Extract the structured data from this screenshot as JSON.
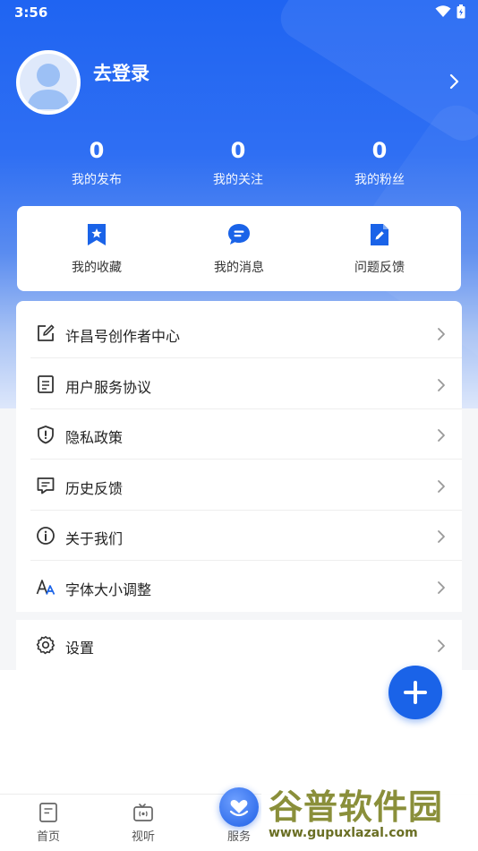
{
  "status_bar": {
    "time": "3:56"
  },
  "profile": {
    "login_text": "去登录"
  },
  "stats": [
    {
      "value": "0",
      "label": "我的发布"
    },
    {
      "value": "0",
      "label": "我的关注"
    },
    {
      "value": "0",
      "label": "我的粉丝"
    }
  ],
  "quick_actions": [
    {
      "label": "我的收藏",
      "icon": "bookmark-icon"
    },
    {
      "label": "我的消息",
      "icon": "message-icon"
    },
    {
      "label": "问题反馈",
      "icon": "edit-doc-icon"
    }
  ],
  "menu": [
    {
      "label": "许昌号创作者中心",
      "icon": "edit-icon"
    },
    {
      "label": "用户服务协议",
      "icon": "document-icon"
    },
    {
      "label": "隐私政策",
      "icon": "shield-icon"
    },
    {
      "label": "历史反馈",
      "icon": "feedback-icon"
    },
    {
      "label": "关于我们",
      "icon": "info-icon"
    },
    {
      "label": "字体大小调整",
      "icon": "font-size-icon"
    }
  ],
  "settings": {
    "label": "设置",
    "icon": "gear-icon"
  },
  "bottom_nav": [
    {
      "label": "首页",
      "icon": "home-doc-icon"
    },
    {
      "label": "视听",
      "icon": "tv-icon"
    },
    {
      "label": "服务",
      "icon": "heart-hand-icon"
    }
  ],
  "watermark": {
    "title": "谷普软件园",
    "url": "www.gupuxlazal.com"
  },
  "colors": {
    "primary": "#1a63e8",
    "hero_top": "#1f64f2"
  }
}
